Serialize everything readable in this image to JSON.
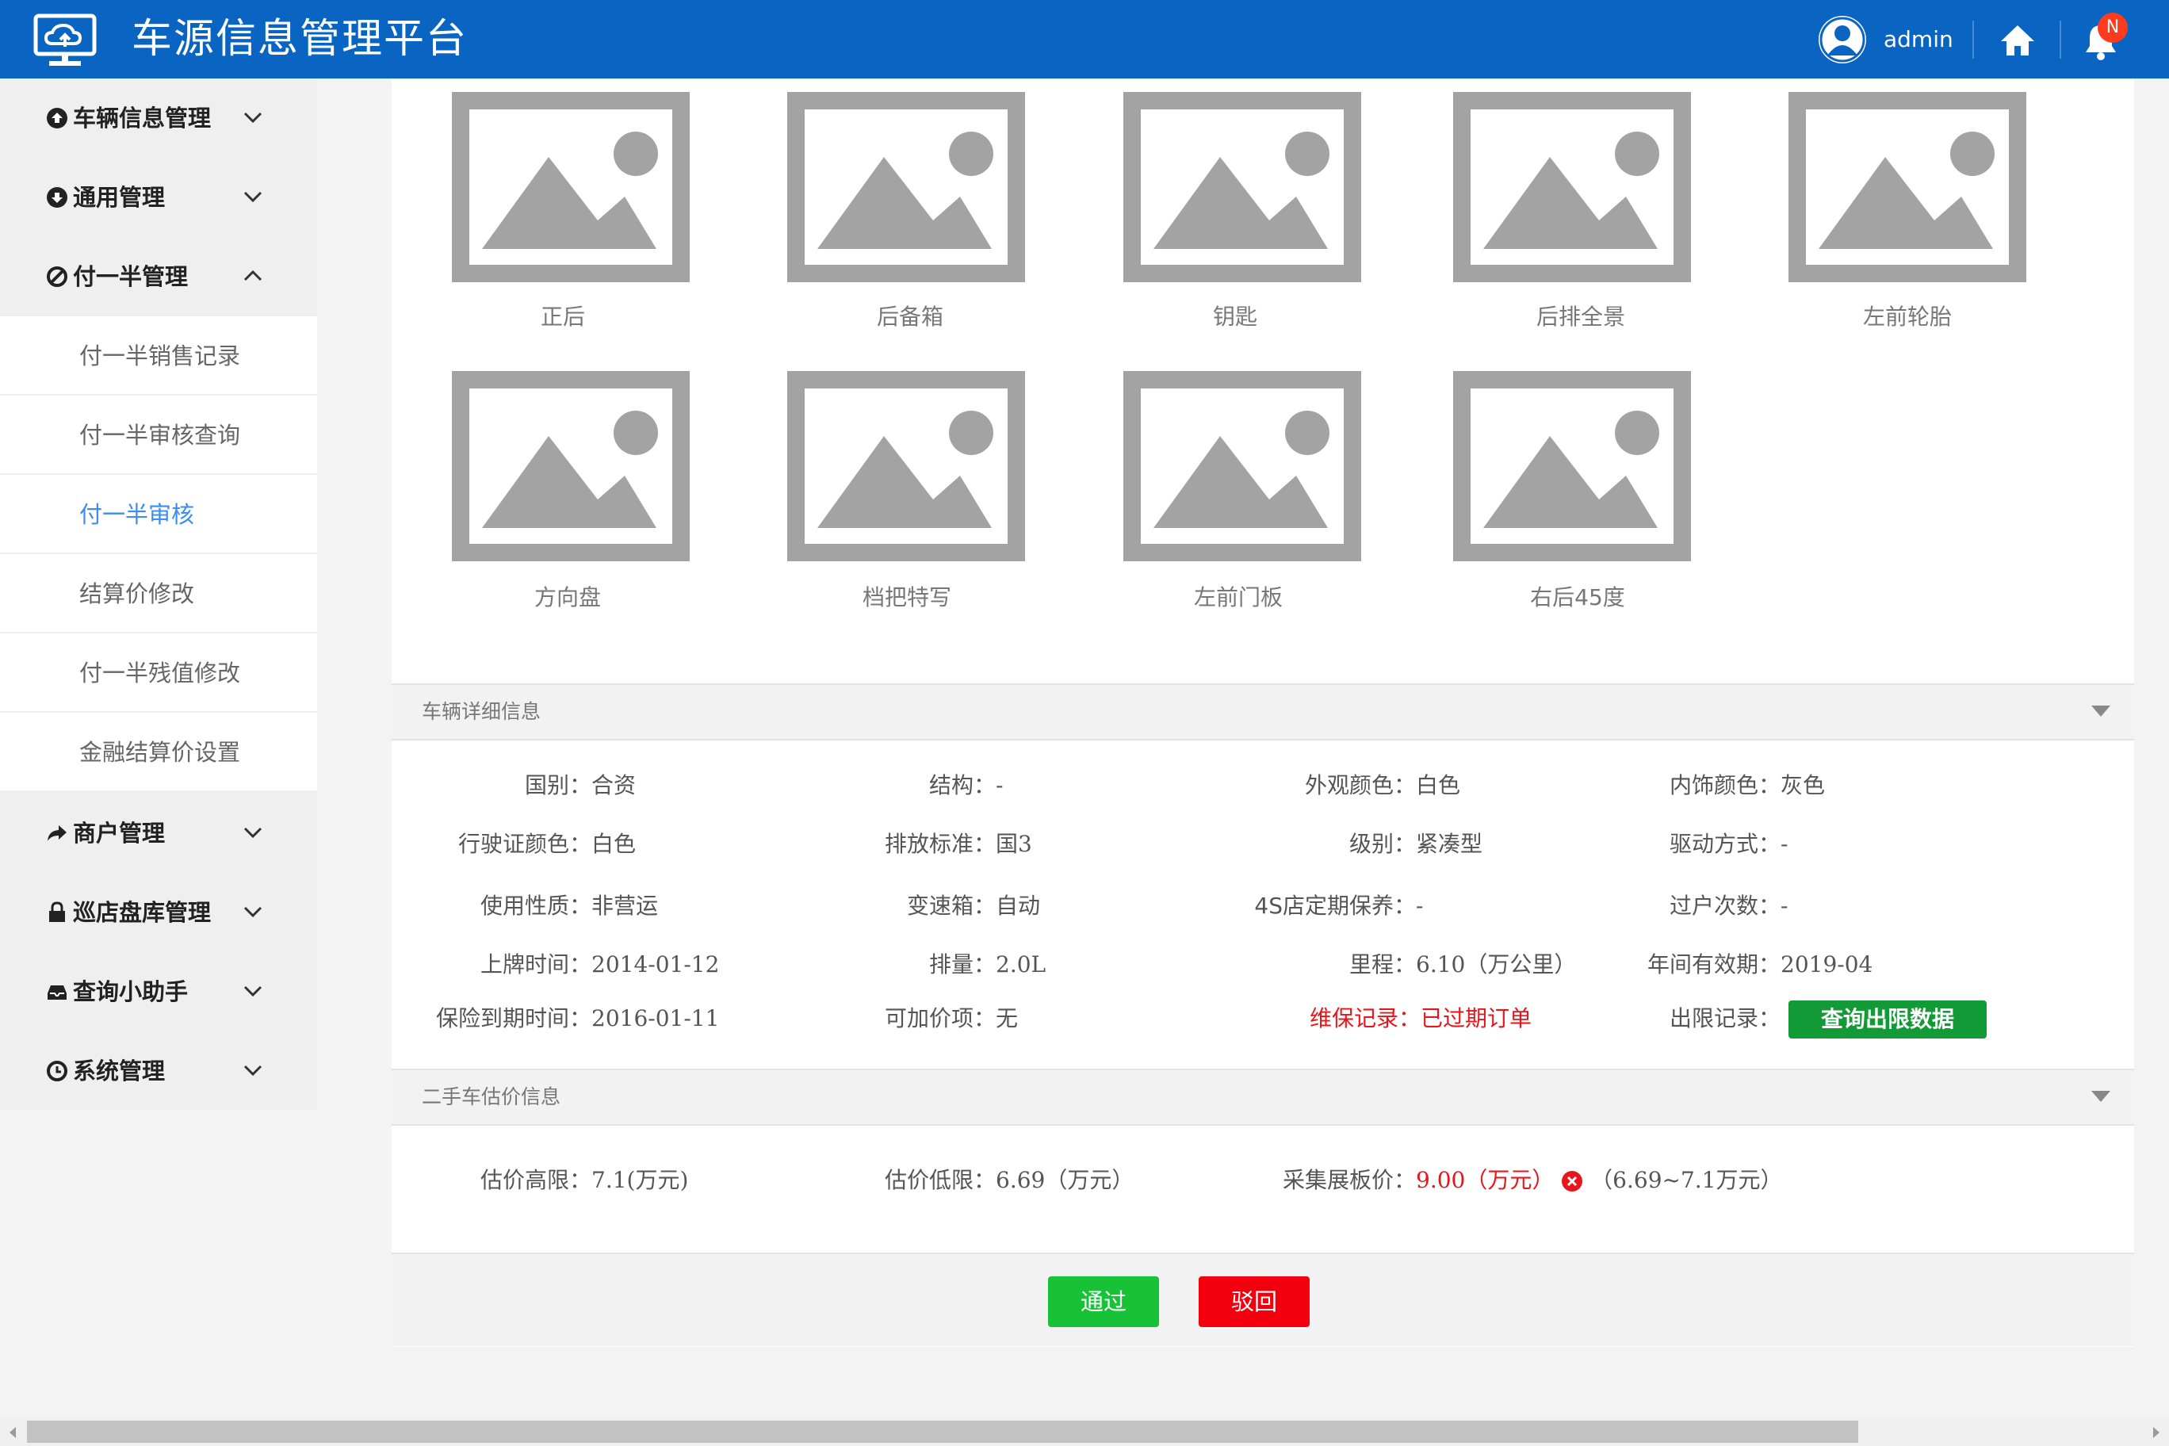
{
  "header": {
    "title": "车源信息管理平台",
    "username": "admin",
    "notification_badge": "N"
  },
  "sidebar": {
    "groups": [
      {
        "label": "车辆信息管理",
        "icon": "arrow-circle-up-icon"
      },
      {
        "label": "通用管理",
        "icon": "arrow-circle-down-icon"
      },
      {
        "label": "付一半管理",
        "icon": "ban-circle-icon"
      },
      {
        "label": "商户管理",
        "icon": "share-arrow-icon"
      },
      {
        "label": "巡店盘库管理",
        "icon": "lock-icon"
      },
      {
        "label": "查询小助手",
        "icon": "inbox-icon"
      },
      {
        "label": "系统管理",
        "icon": "clock-icon"
      }
    ],
    "subitems": [
      {
        "label": "付一半销售记录"
      },
      {
        "label": "付一半审核查询"
      },
      {
        "label": "付一半审核",
        "active": true
      },
      {
        "label": "结算价修改"
      },
      {
        "label": "付一半残值修改"
      },
      {
        "label": "金融结算价设置"
      }
    ]
  },
  "photos": [
    {
      "label": "正后"
    },
    {
      "label": "后备箱"
    },
    {
      "label": "钥匙"
    },
    {
      "label": "后排全景"
    },
    {
      "label": "左前轮胎"
    },
    {
      "label": "方向盘"
    },
    {
      "label": "档把特写"
    },
    {
      "label": "左前门板"
    },
    {
      "label": "右后45度"
    }
  ],
  "vehicle_details": {
    "title": "车辆详细信息",
    "fields": [
      {
        "label": "国别：",
        "value": "合资"
      },
      {
        "label": "结构：",
        "value": "-"
      },
      {
        "label": "外观颜色：",
        "value": "白色"
      },
      {
        "label": "内饰颜色：",
        "value": "灰色"
      },
      {
        "label": "行驶证颜色：",
        "value": "白色"
      },
      {
        "label": "排放标准：",
        "value": "国3"
      },
      {
        "label": "级别：",
        "value": "紧凑型"
      },
      {
        "label": "驱动方式：",
        "value": "-"
      },
      {
        "label": "使用性质：",
        "value": "非营运"
      },
      {
        "label": "变速箱：",
        "value": "自动"
      },
      {
        "label": "4S店定期保养：",
        "value": "-"
      },
      {
        "label": "过户次数：",
        "value": "-"
      },
      {
        "label": "上牌时间：",
        "value": "2014-01-12"
      },
      {
        "label": "排量：",
        "value": "2.0L"
      },
      {
        "label": "里程：",
        "value": "6.10（万公里）"
      },
      {
        "label": "年间有效期：",
        "value": "2019-04"
      },
      {
        "label": "保险到期时间：",
        "value": "2016-01-11"
      },
      {
        "label": "可加价项：",
        "value": "无"
      }
    ],
    "maintenance": {
      "label": "维保记录：",
      "value": "已过期订单"
    },
    "limit_record": {
      "label": "出限记录：",
      "button": "查询出限数据"
    }
  },
  "valuation": {
    "title": "二手车估价信息",
    "high": {
      "label": "估价高限：",
      "value": "7.1(万元)"
    },
    "low": {
      "label": "估价低限：",
      "value": "6.69（万元）"
    },
    "collected": {
      "label": "采集展板价：",
      "value": "9.00（万元）",
      "range": "（6.69~7.1万元）"
    }
  },
  "actions": {
    "pass": "通过",
    "reject": "驳回"
  }
}
